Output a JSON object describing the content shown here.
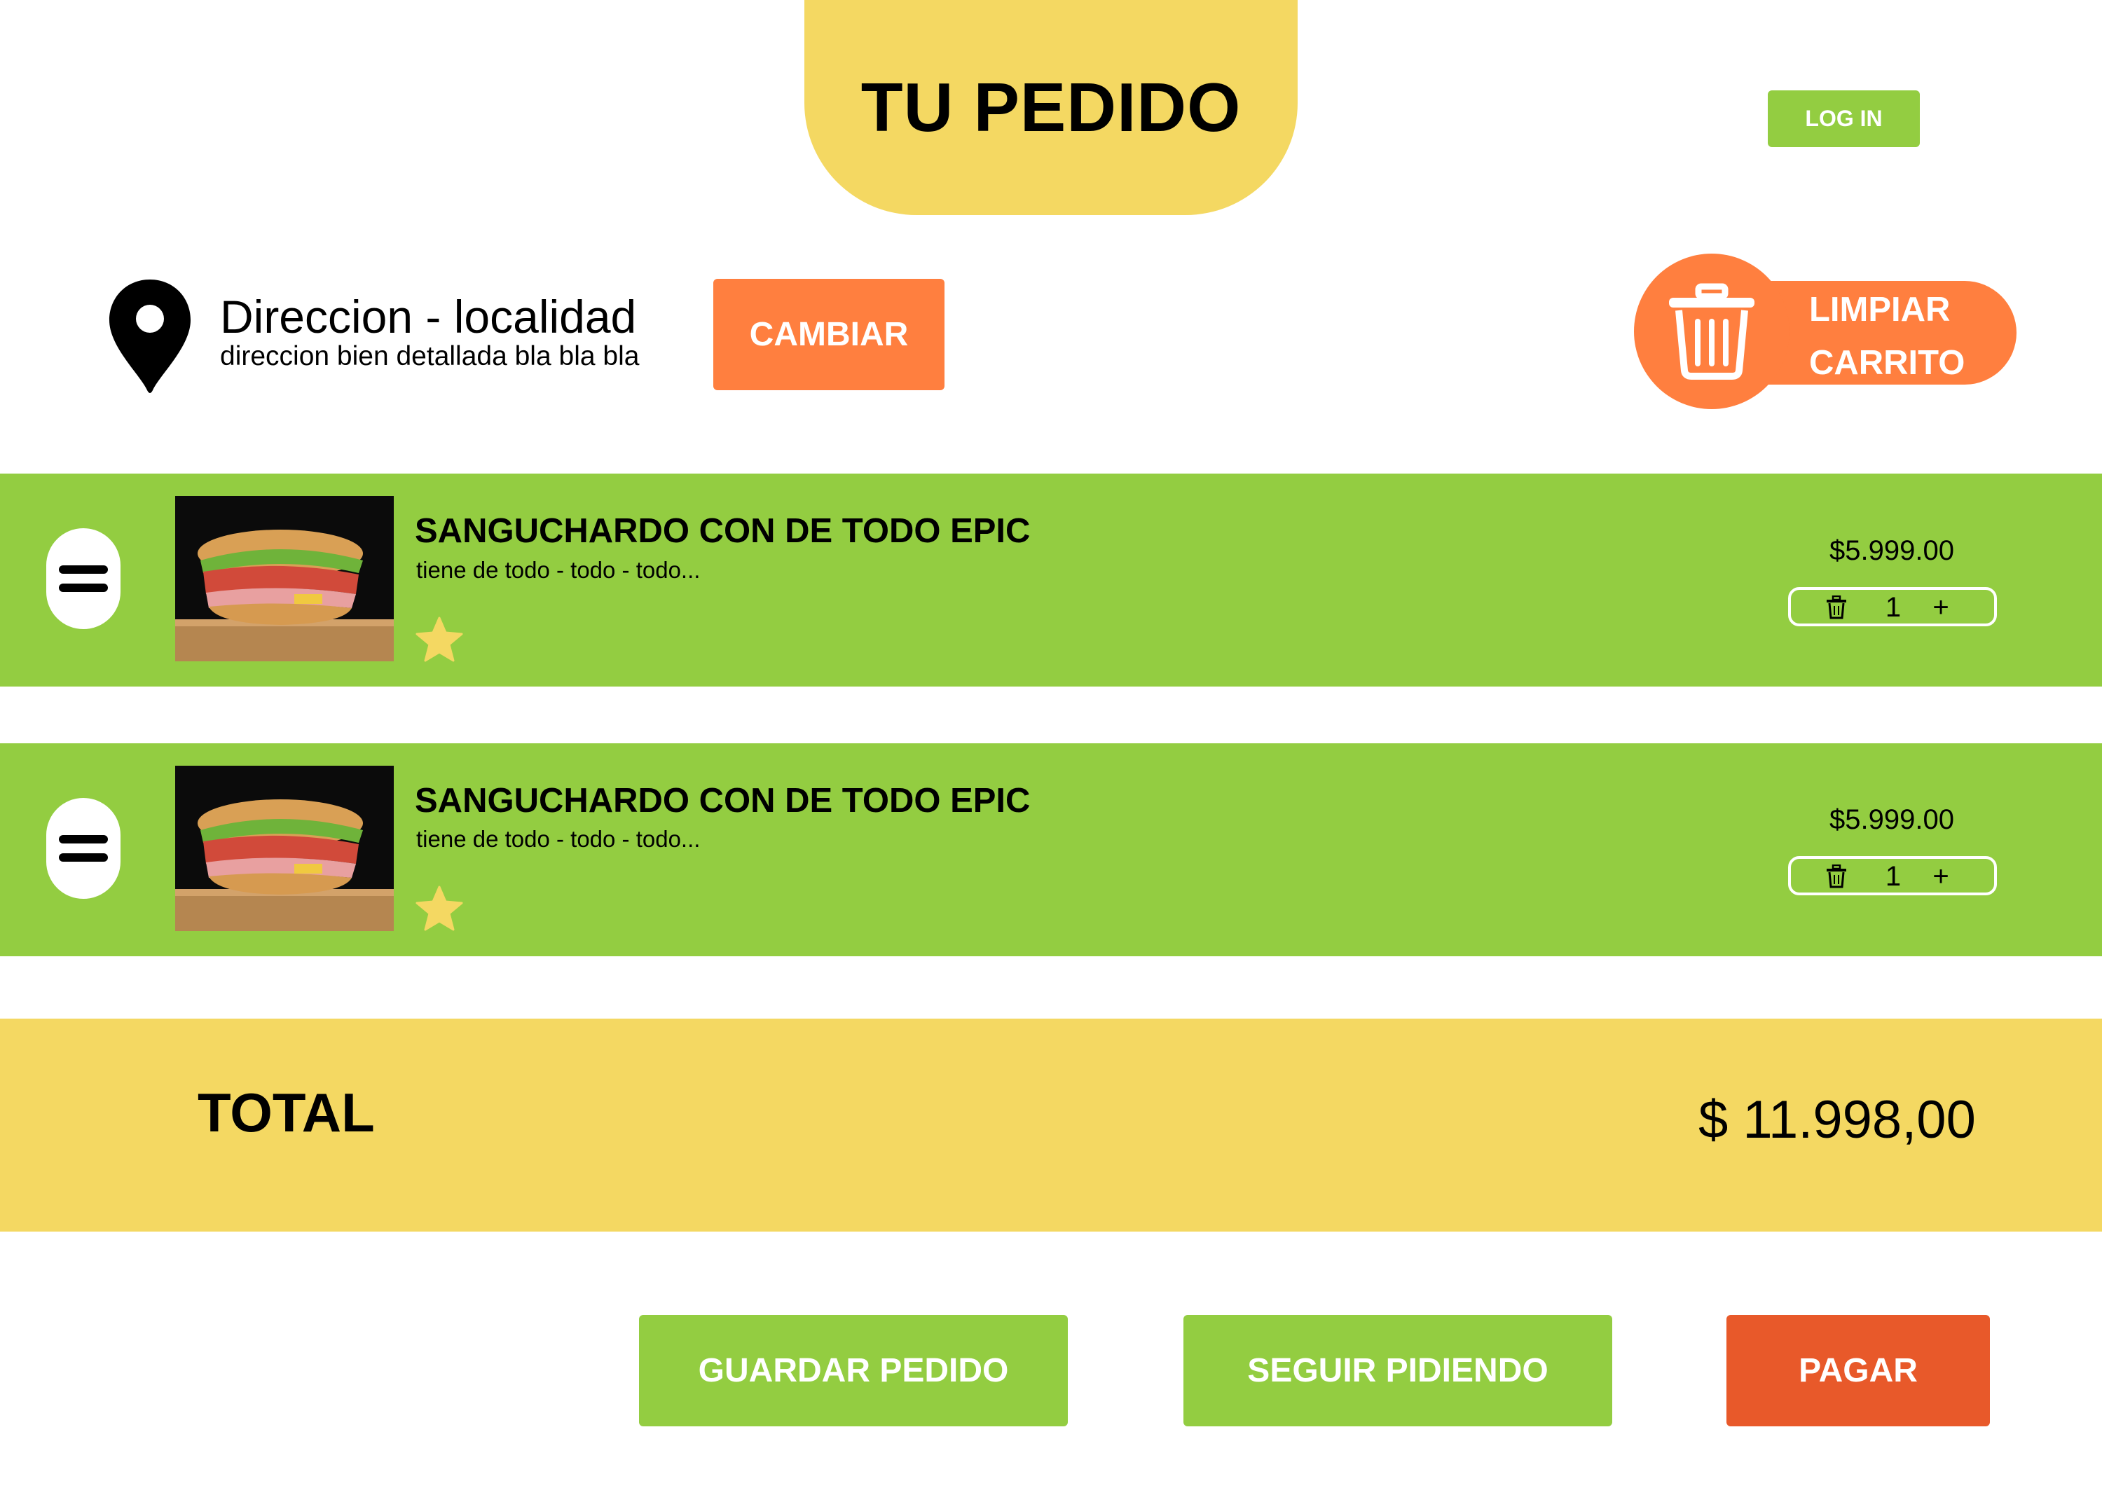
{
  "header": {
    "title": "TU PEDIDO",
    "login_label": "LOG IN"
  },
  "address": {
    "main": "Direccion - localidad",
    "detail": "direccion bien detallada bla bla bla",
    "change_label": "CAMBIAR",
    "icon": "location-pin-icon"
  },
  "cart": {
    "clear_line1": "LIMPIAR",
    "clear_line2": "CARRITO",
    "clear_icon": "trash-icon"
  },
  "items": [
    {
      "name": "SANGUCHARDO CON DE TODO EPIC",
      "description": "tiene de todo - todo - todo...",
      "price": "$5.999.00",
      "quantity": "1",
      "plus": "+"
    },
    {
      "name": "SANGUCHARDO CON DE TODO EPIC",
      "description": "tiene de todo - todo - todo...",
      "price": "$5.999.00",
      "quantity": "1",
      "plus": "+"
    }
  ],
  "total": {
    "label": "TOTAL",
    "value": "$ 11.998,00"
  },
  "actions": {
    "save": "GUARDAR PEDIDO",
    "continue": "SEGUIR PIDIENDO",
    "pay": "PAGAR"
  },
  "colors": {
    "green": "#93cd41",
    "yellow": "#f4d862",
    "orange": "#ff7f3f",
    "red_orange": "#e8592a"
  }
}
